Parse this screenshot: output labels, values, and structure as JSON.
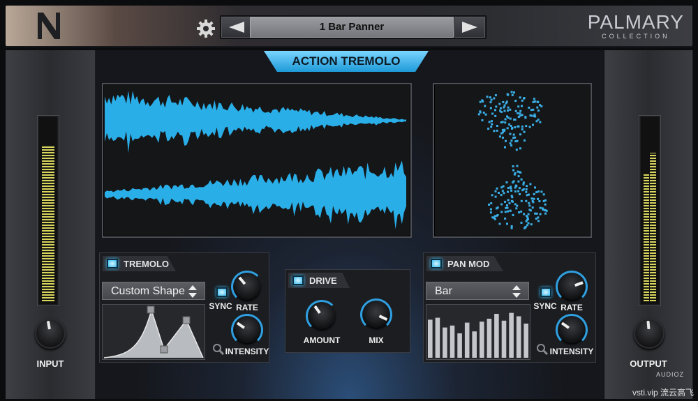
{
  "header": {
    "preset_name": "1 Bar Panner",
    "brand_main": "PALMARY",
    "brand_sub": "COLLECTION"
  },
  "title": "ACTION TREMOLO",
  "input": {
    "label": "INPUT",
    "meter_level": 0.86
  },
  "output": {
    "label": "OUTPUT",
    "meter_level": 0.82
  },
  "tremolo": {
    "label": "TREMOLO",
    "shape": "Custom Shape",
    "sync_label": "SYNC",
    "rate_label": "RATE",
    "intensity_label": "INTENSITY"
  },
  "drive": {
    "label": "DRIVE",
    "amount_label": "AMOUNT",
    "mix_label": "MIX"
  },
  "panmod": {
    "label": "PAN MOD",
    "shape": "Bar",
    "sync_label": "SYNC",
    "rate_label": "RATE",
    "intensity_label": "INTENSITY",
    "bars": [
      0.78,
      0.82,
      0.62,
      0.66,
      0.5,
      0.72,
      0.54,
      0.74,
      0.8,
      0.9,
      0.76,
      0.92,
      0.85,
      0.7
    ]
  },
  "watermark": "vsti.vip 流云高飞",
  "watermark_small": "AUDIOZ",
  "colors": {
    "accent": "#2f9fe0",
    "meter": "#d9d65c"
  }
}
